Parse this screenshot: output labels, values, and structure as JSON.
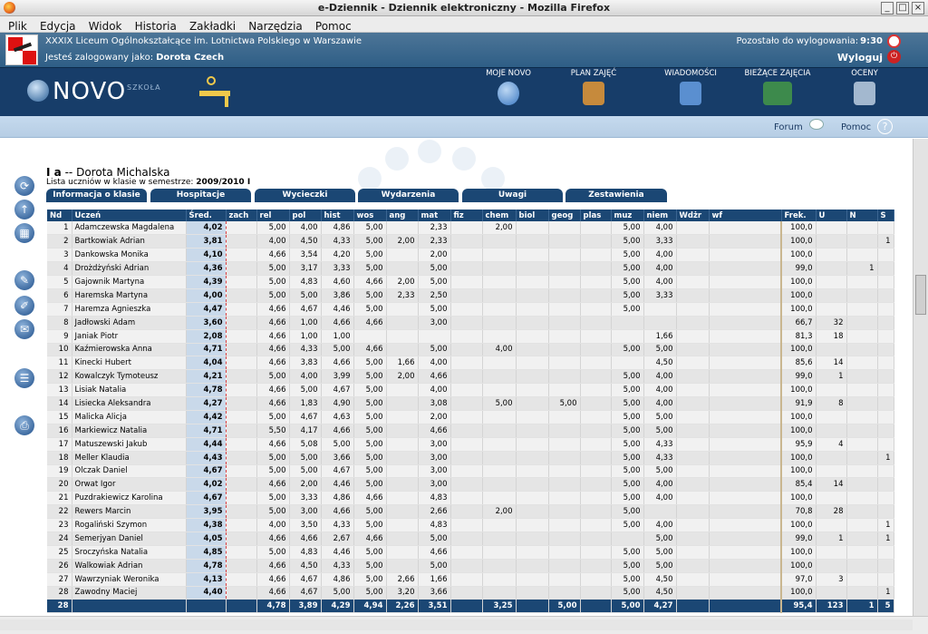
{
  "window": {
    "title": "e-Dziennik - Dziennik elektroniczny - Mozilla Firefox"
  },
  "menu": [
    "Plik",
    "Edycja",
    "Widok",
    "Historia",
    "Zakładki",
    "Narzędzia",
    "Pomoc"
  ],
  "header": {
    "school": "XXXIX Liceum Ogólnokształcące im. Lotnictwa Polskiego w Warszawie",
    "logged_label": "Jesteś zalogowany jako:",
    "user": "Dorota Czech",
    "logout_time_label": "Pozostało do wylogowania:",
    "logout_time": "9:30",
    "logout": "Wyloguj"
  },
  "brand": {
    "word": "NOVO",
    "sub": "SZKOŁA"
  },
  "nav": [
    {
      "label": "MOJE NOVO",
      "color": "#3a78c2"
    },
    {
      "label": "PLAN ZAJĘĆ",
      "color": "#c68a3c"
    },
    {
      "label": "WIADOMOŚCI",
      "color": "#5a8fd0"
    },
    {
      "label": "BIEŻĄCE ZAJĘCIA",
      "color": "#3d8a4c"
    },
    {
      "label": "OCENY",
      "color": "#a3b8cf"
    }
  ],
  "subbar": {
    "forum": "Forum",
    "help": "Pomoc"
  },
  "page": {
    "class": "I a",
    "separator": "--",
    "teacher": "Dorota Michalska",
    "list_label": "Lista uczniów w klasie w semestrze:",
    "semester": "2009/2010 I"
  },
  "tabs": [
    "Informacja o klasie",
    "Hospitacje",
    "Wycieczki",
    "Wydarzenia",
    "Uwagi",
    "Zestawienia"
  ],
  "table": {
    "headers": [
      "Nd",
      "Uczeń",
      "Śred.",
      "zach",
      "rel",
      "pol",
      "hist",
      "wos",
      "ang",
      "mat",
      "fiz",
      "chem",
      "biol",
      "geog",
      "plas",
      "muz",
      "niem",
      "Wdżr",
      "wf",
      "Frek.",
      "U",
      "N",
      "S"
    ],
    "rows": [
      [
        "1",
        "Adamczewska Magdalena",
        "4,02",
        "",
        "5,00",
        "4,00",
        "4,86",
        "5,00",
        "",
        "2,33",
        "",
        "2,00",
        "",
        "",
        "",
        "5,00",
        "4,00",
        "",
        "",
        "100,0",
        "",
        "",
        ""
      ],
      [
        "2",
        "Bartkowiak Adrian",
        "3,81",
        "",
        "4,00",
        "4,50",
        "4,33",
        "5,00",
        "2,00",
        "2,33",
        "",
        "",
        "",
        "",
        "",
        "5,00",
        "3,33",
        "",
        "",
        "100,0",
        "",
        "",
        "1"
      ],
      [
        "3",
        "Dankowska Monika",
        "4,10",
        "",
        "4,66",
        "3,54",
        "4,20",
        "5,00",
        "",
        "2,00",
        "",
        "",
        "",
        "",
        "",
        "5,00",
        "4,00",
        "",
        "",
        "100,0",
        "",
        "",
        ""
      ],
      [
        "4",
        "Drożdżyński Adrian",
        "4,36",
        "",
        "5,00",
        "3,17",
        "3,33",
        "5,00",
        "",
        "5,00",
        "",
        "",
        "",
        "",
        "",
        "5,00",
        "4,00",
        "",
        "",
        "99,0",
        "",
        "1",
        ""
      ],
      [
        "5",
        "Gajownik Martyna",
        "4,39",
        "",
        "5,00",
        "4,83",
        "4,60",
        "4,66",
        "2,00",
        "5,00",
        "",
        "",
        "",
        "",
        "",
        "5,00",
        "4,00",
        "",
        "",
        "100,0",
        "",
        "",
        ""
      ],
      [
        "6",
        "Haremska Martyna",
        "4,00",
        "",
        "5,00",
        "5,00",
        "3,86",
        "5,00",
        "2,33",
        "2,50",
        "",
        "",
        "",
        "",
        "",
        "5,00",
        "3,33",
        "",
        "",
        "100,0",
        "",
        "",
        ""
      ],
      [
        "7",
        "Haremza Agnieszka",
        "4,47",
        "",
        "4,66",
        "4,67",
        "4,46",
        "5,00",
        "",
        "5,00",
        "",
        "",
        "",
        "",
        "",
        "5,00",
        "",
        "",
        "",
        "100,0",
        "",
        "",
        ""
      ],
      [
        "8",
        "Jadłowski Adam",
        "3,60",
        "",
        "4,66",
        "1,00",
        "4,66",
        "4,66",
        "",
        "3,00",
        "",
        "",
        "",
        "",
        "",
        "",
        "",
        "",
        "",
        "66,7",
        "32",
        "",
        ""
      ],
      [
        "9",
        "Janiak Piotr",
        "2,08",
        "",
        "4,66",
        "1,00",
        "1,00",
        "",
        "",
        "",
        "",
        "",
        "",
        "",
        "",
        "",
        "1,66",
        "",
        "",
        "81,3",
        "18",
        "",
        ""
      ],
      [
        "10",
        "Kaźmierowska Anna",
        "4,71",
        "",
        "4,66",
        "4,33",
        "5,00",
        "4,66",
        "",
        "5,00",
        "",
        "4,00",
        "",
        "",
        "",
        "5,00",
        "5,00",
        "",
        "",
        "100,0",
        "",
        "",
        ""
      ],
      [
        "11",
        "Kinecki Hubert",
        "4,04",
        "",
        "4,66",
        "3,83",
        "4,66",
        "5,00",
        "1,66",
        "4,00",
        "",
        "",
        "",
        "",
        "",
        "",
        "4,50",
        "",
        "",
        "85,6",
        "14",
        "",
        ""
      ],
      [
        "12",
        "Kowalczyk Tymoteusz",
        "4,21",
        "",
        "5,00",
        "4,00",
        "3,99",
        "5,00",
        "2,00",
        "4,66",
        "",
        "",
        "",
        "",
        "",
        "5,00",
        "4,00",
        "",
        "",
        "99,0",
        "1",
        "",
        ""
      ],
      [
        "13",
        "Lisiak Natalia",
        "4,78",
        "",
        "4,66",
        "5,00",
        "4,67",
        "5,00",
        "",
        "4,00",
        "",
        "",
        "",
        "",
        "",
        "5,00",
        "4,00",
        "",
        "",
        "100,0",
        "",
        "",
        ""
      ],
      [
        "14",
        "Lisiecka Aleksandra",
        "4,27",
        "",
        "4,66",
        "1,83",
        "4,90",
        "5,00",
        "",
        "3,08",
        "",
        "5,00",
        "",
        "5,00",
        "",
        "5,00",
        "4,00",
        "",
        "",
        "91,9",
        "8",
        "",
        ""
      ],
      [
        "15",
        "Malicka Alicja",
        "4,42",
        "",
        "5,00",
        "4,67",
        "4,63",
        "5,00",
        "",
        "2,00",
        "",
        "",
        "",
        "",
        "",
        "5,00",
        "5,00",
        "",
        "",
        "100,0",
        "",
        "",
        ""
      ],
      [
        "16",
        "Markiewicz Natalia",
        "4,71",
        "",
        "5,50",
        "4,17",
        "4,66",
        "5,00",
        "",
        "4,66",
        "",
        "",
        "",
        "",
        "",
        "5,00",
        "5,00",
        "",
        "",
        "100,0",
        "",
        "",
        ""
      ],
      [
        "17",
        "Matuszewski Jakub",
        "4,44",
        "",
        "4,66",
        "5,08",
        "5,00",
        "5,00",
        "",
        "3,00",
        "",
        "",
        "",
        "",
        "",
        "5,00",
        "4,33",
        "",
        "",
        "95,9",
        "4",
        "",
        ""
      ],
      [
        "18",
        "Meller Klaudia",
        "4,43",
        "",
        "5,00",
        "5,00",
        "3,66",
        "5,00",
        "",
        "3,00",
        "",
        "",
        "",
        "",
        "",
        "5,00",
        "4,33",
        "",
        "",
        "100,0",
        "",
        "",
        "1"
      ],
      [
        "19",
        "Olczak Daniel",
        "4,67",
        "",
        "5,00",
        "5,00",
        "4,67",
        "5,00",
        "",
        "3,00",
        "",
        "",
        "",
        "",
        "",
        "5,00",
        "5,00",
        "",
        "",
        "100,0",
        "",
        "",
        ""
      ],
      [
        "20",
        "Orwat Igor",
        "4,02",
        "",
        "4,66",
        "2,00",
        "4,46",
        "5,00",
        "",
        "3,00",
        "",
        "",
        "",
        "",
        "",
        "5,00",
        "4,00",
        "",
        "",
        "85,4",
        "14",
        "",
        ""
      ],
      [
        "21",
        "Puzdrakiewicz Karolina",
        "4,67",
        "",
        "5,00",
        "3,33",
        "4,86",
        "4,66",
        "",
        "4,83",
        "",
        "",
        "",
        "",
        "",
        "5,00",
        "4,00",
        "",
        "",
        "100,0",
        "",
        "",
        ""
      ],
      [
        "22",
        "Rewers Marcin",
        "3,95",
        "",
        "5,00",
        "3,00",
        "4,66",
        "5,00",
        "",
        "2,66",
        "",
        "2,00",
        "",
        "",
        "",
        "5,00",
        "",
        "",
        "",
        "70,8",
        "28",
        "",
        ""
      ],
      [
        "23",
        "Rogaliński Szymon",
        "4,38",
        "",
        "4,00",
        "3,50",
        "4,33",
        "5,00",
        "",
        "4,83",
        "",
        "",
        "",
        "",
        "",
        "5,00",
        "4,00",
        "",
        "",
        "100,0",
        "",
        "",
        "1"
      ],
      [
        "24",
        "Semerjyan Daniel",
        "4,05",
        "",
        "4,66",
        "4,66",
        "2,67",
        "4,66",
        "",
        "5,00",
        "",
        "",
        "",
        "",
        "",
        "",
        "5,00",
        "",
        "",
        "99,0",
        "1",
        "",
        "1"
      ],
      [
        "25",
        "Sroczyńska Natalia",
        "4,85",
        "",
        "5,00",
        "4,83",
        "4,46",
        "5,00",
        "",
        "4,66",
        "",
        "",
        "",
        "",
        "",
        "5,00",
        "5,00",
        "",
        "",
        "100,0",
        "",
        "",
        ""
      ],
      [
        "26",
        "Walkowiak Adrian",
        "4,78",
        "",
        "4,66",
        "4,50",
        "4,33",
        "5,00",
        "",
        "5,00",
        "",
        "",
        "",
        "",
        "",
        "5,00",
        "5,00",
        "",
        "",
        "100,0",
        "",
        "",
        ""
      ],
      [
        "27",
        "Wawrzyniak Weronika",
        "4,13",
        "",
        "4,66",
        "4,67",
        "4,86",
        "5,00",
        "2,66",
        "1,66",
        "",
        "",
        "",
        "",
        "",
        "5,00",
        "4,50",
        "",
        "",
        "97,0",
        "3",
        "",
        ""
      ],
      [
        "28",
        "Zawodny Maciej",
        "4,40",
        "",
        "4,66",
        "4,67",
        "5,00",
        "5,00",
        "3,20",
        "3,66",
        "",
        "",
        "",
        "",
        "",
        "5,00",
        "4,50",
        "",
        "",
        "100,0",
        "",
        "",
        "1"
      ]
    ],
    "total": [
      "28",
      "",
      "",
      "",
      "4,78",
      "3,89",
      "4,29",
      "4,94",
      "2,26",
      "3,51",
      "",
      "3,25",
      "",
      "5,00",
      "",
      "5,00",
      "4,27",
      "",
      "",
      "95,4",
      "123",
      "1",
      "5"
    ]
  }
}
